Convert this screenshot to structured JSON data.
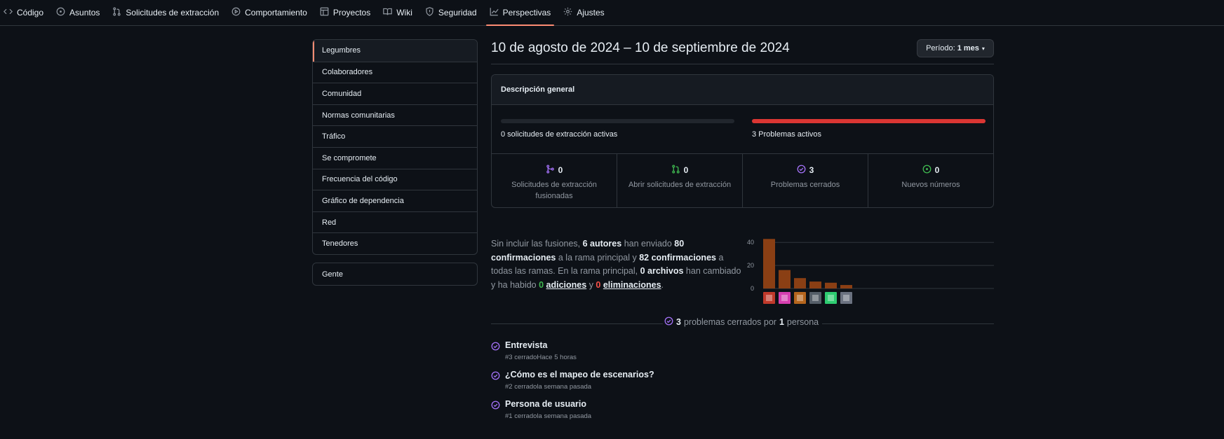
{
  "nav": {
    "tabs": [
      {
        "label": "Código",
        "icon": "code-icon"
      },
      {
        "label": "Asuntos",
        "icon": "issue-icon"
      },
      {
        "label": "Solicitudes de extracción",
        "icon": "pull-request-icon"
      },
      {
        "label": "Comportamiento",
        "icon": "play-icon"
      },
      {
        "label": "Proyectos",
        "icon": "table-icon"
      },
      {
        "label": "Wiki",
        "icon": "book-icon"
      },
      {
        "label": "Seguridad",
        "icon": "shield-icon"
      },
      {
        "label": "Perspectivas",
        "icon": "graph-icon",
        "active": true
      },
      {
        "label": "Ajustes",
        "icon": "gear-icon"
      }
    ]
  },
  "sidebar": {
    "items": [
      "Legumbres",
      "Colaboradores",
      "Comunidad",
      "Normas comunitarias",
      "Tráfico",
      "Se compromete",
      "Frecuencia del código",
      "Gráfico de dependencia",
      "Red",
      "Tenedores"
    ],
    "people": "Gente"
  },
  "header": {
    "date_range": "10 de agosto de 2024 – 10 de septiembre de 2024",
    "period_label": "Período:",
    "period_value": "1 mes"
  },
  "overview": {
    "title": "Descripción general",
    "pr_label": "0 solicitudes de extracción activas",
    "issues_label": "3 Problemas activos",
    "pr_fill": 0,
    "issues_fill": 1,
    "stats": [
      {
        "num": "0",
        "label": "Solicitudes de extracción fusionadas",
        "icon": "merged-icon",
        "color": "#a371f7"
      },
      {
        "num": "0",
        "label": "Abrir solicitudes de extracción",
        "icon": "pull-request-icon",
        "color": "#3fb950"
      },
      {
        "num": "3",
        "label": "Problemas cerrados",
        "icon": "issue-closed-icon",
        "color": "#a371f7"
      },
      {
        "num": "0",
        "label": "Nuevos números",
        "icon": "issue-opened-icon",
        "color": "#3fb950"
      }
    ]
  },
  "summary": {
    "p1": "Sin incluir las fusiones, ",
    "authors": "6 autores",
    "p2": " han enviado ",
    "commits_main": "80 confirmaciones",
    "p3": " a la rama principal y ",
    "commits_all": "82 confirmaciones",
    "p4": " a todas las ramas. En la rama principal, ",
    "files": "0 archivos",
    "p5": " han cambiado y ha habido ",
    "add_num": "0",
    "add_label": "adiciones",
    "p6": " y ",
    "del_num": "0",
    "del_label": "eliminaciones",
    "p7": "."
  },
  "chart_data": {
    "type": "bar",
    "categories": [
      "autor 1",
      "autor 2",
      "autor 3",
      "autor 4",
      "autor 5",
      "autor 6"
    ],
    "values": [
      43,
      16,
      9,
      6,
      5,
      3
    ],
    "ylim": [
      0,
      45
    ],
    "yticks": [
      "40",
      "20",
      "0"
    ],
    "bar_color": "#8a3f14"
  },
  "closed": {
    "count": "3",
    "mid": " problemas cerrados por ",
    "people": "1",
    "end": " persona"
  },
  "issues": [
    {
      "title": "Entrevista",
      "meta": "#3 cerradoHace 5 horas"
    },
    {
      "title": "¿Cómo es el mapeo de escenarios?",
      "meta": "#2 cerradola semana pasada"
    },
    {
      "title": "Persona de usuario",
      "meta": "#1 cerradola semana pasada"
    }
  ]
}
